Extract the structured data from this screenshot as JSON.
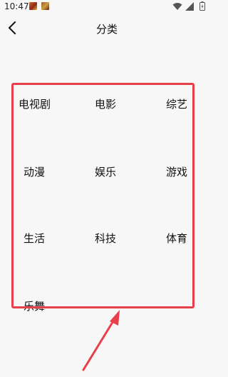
{
  "status_bar": {
    "time": "10:47"
  },
  "header": {
    "title": "分类"
  },
  "categories": [
    {
      "label": "电视剧"
    },
    {
      "label": "电影"
    },
    {
      "label": "综艺"
    },
    {
      "label": "动漫"
    },
    {
      "label": "娱乐"
    },
    {
      "label": "游戏"
    },
    {
      "label": "生活"
    },
    {
      "label": "科技"
    },
    {
      "label": "体育"
    },
    {
      "label": "乐舞"
    }
  ],
  "colors": {
    "background": "#f7f7f7",
    "annotation": "#e8404a",
    "text": "#111111"
  },
  "icons": {
    "back": "chevron-left-icon",
    "wifi": "wifi-icon",
    "signal": "signal-icon",
    "battery": "battery-icon"
  }
}
